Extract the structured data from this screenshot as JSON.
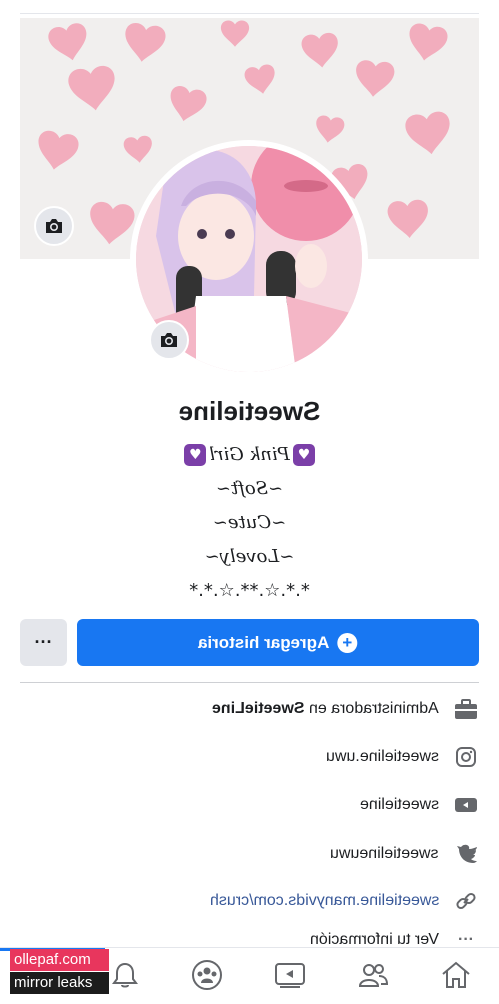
{
  "profile": {
    "name": "Sweetieline",
    "bio_lines": [
      "Pink Girl",
      "~Soft~",
      "~Cute~",
      "~Lovely~",
      "*.*.☆.**.☆.*.*"
    ]
  },
  "actions": {
    "add_story_label": "Agregar historia",
    "more_label": "···"
  },
  "info": [
    {
      "icon": "briefcase-icon",
      "text": "Administradora en SweetieLine",
      "bold_part": "SweetieLine"
    },
    {
      "icon": "instagram-icon",
      "text": "sweetieline.uwu"
    },
    {
      "icon": "youtube-icon",
      "text": "sweetieline"
    },
    {
      "icon": "twitter-icon",
      "text": "sweetielineuwu"
    },
    {
      "icon": "link-icon",
      "text": "sweetieline.manyvids.com/crush"
    },
    {
      "icon": "ellipsis-icon",
      "text": "Ver tu información"
    }
  ],
  "nav": [
    "home-icon",
    "friends-icon",
    "watch-icon",
    "groups-icon",
    "notifications-icon",
    "menu-icon"
  ],
  "watermark": {
    "line1": "ollepaf.com",
    "line2": "mirror leaks"
  },
  "colors": {
    "accent": "#1877f2",
    "cover_hearts": "#f39bb1",
    "link": "#385898"
  }
}
